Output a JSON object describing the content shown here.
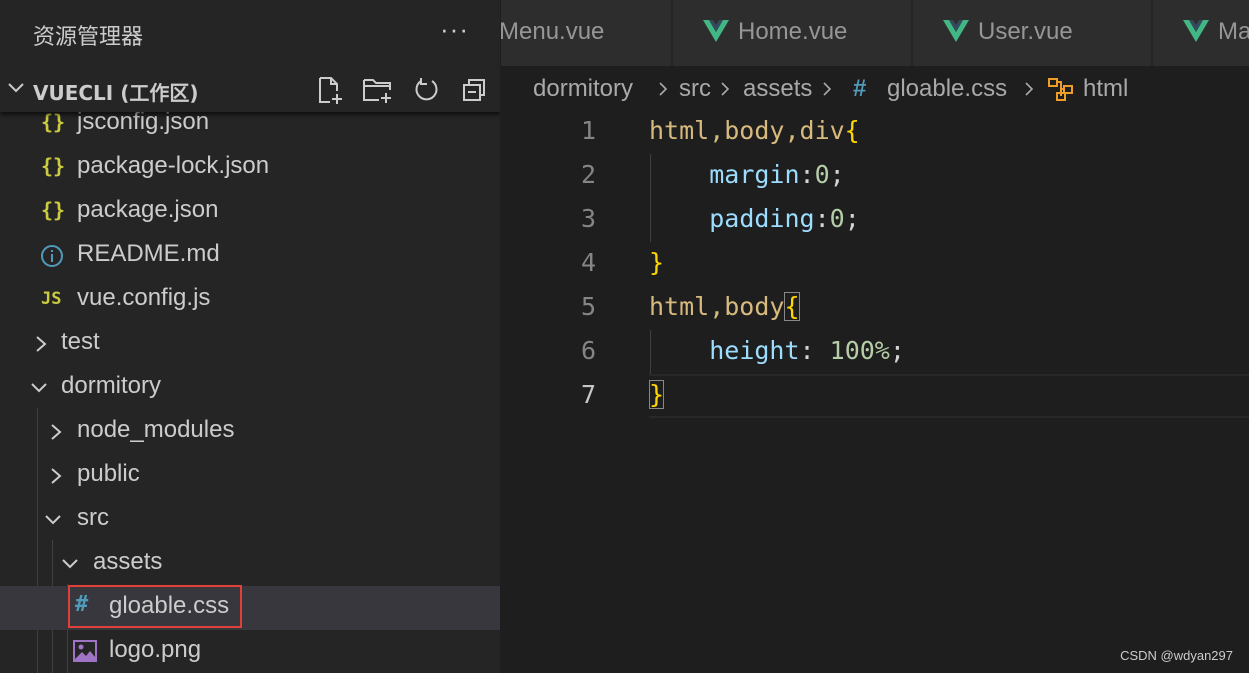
{
  "explorer": {
    "title": "资源管理器",
    "more": "···",
    "workspace": "VUECLI (工作区)",
    "items": [
      {
        "icon": "{}",
        "label": "jsconfig.json"
      },
      {
        "icon": "{}",
        "label": "package-lock.json"
      },
      {
        "icon": "{}",
        "label": "package.json"
      },
      {
        "icon": "i",
        "label": "README.md"
      },
      {
        "icon": "JS",
        "label": "vue.config.js"
      },
      {
        "label": "test"
      },
      {
        "label": "dormitory"
      },
      {
        "label": "node_modules"
      },
      {
        "label": "public"
      },
      {
        "label": "src"
      },
      {
        "label": "assets"
      },
      {
        "icon": "#",
        "label": "gloable.css"
      },
      {
        "label": "logo.png"
      }
    ]
  },
  "tabs": [
    {
      "label": "Menu.vue"
    },
    {
      "label": "Home.vue"
    },
    {
      "label": "User.vue"
    },
    {
      "label": "Ma"
    }
  ],
  "breadcrumb": {
    "items": [
      "dormitory",
      "src",
      "assets",
      "gloable.css",
      "html"
    ],
    "hash": "#"
  },
  "code": {
    "line_numbers": [
      "1",
      "2",
      "3",
      "4",
      "5",
      "6",
      "7"
    ],
    "lines": [
      {
        "sel": "html,body,div",
        "brace": "{"
      },
      {
        "prop": "margin",
        "colon": ":",
        "num": "0",
        "semi": ";"
      },
      {
        "prop": "padding",
        "colon": ":",
        "num": "0",
        "semi": ";"
      },
      {
        "brace": "}"
      },
      {
        "sel": "html,body",
        "brace": "{"
      },
      {
        "prop": "height",
        "colon": ": ",
        "num": "100%",
        "semi": ";"
      },
      {
        "brace": "}"
      }
    ]
  },
  "colors": {
    "selection_box": "#e0403a",
    "vue_green": "#41b883",
    "json_yellow": "#cbcb41",
    "css_blue": "#519aba",
    "brace_gold": "#ffd700"
  },
  "watermark": "CSDN @wdyan297"
}
